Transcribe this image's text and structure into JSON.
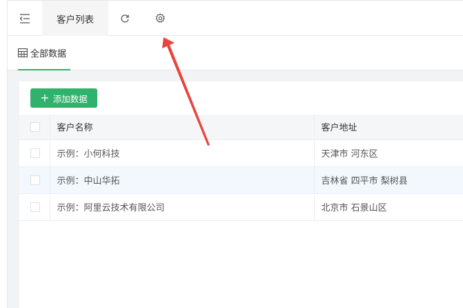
{
  "topbar": {
    "tab_label": "客户列表",
    "icons": [
      "menu-fold-icon",
      "refresh-icon",
      "gear-icon"
    ]
  },
  "view_tab": {
    "label": "全部数据",
    "icon": "table-icon"
  },
  "toolbar": {
    "add_label": "添加数据",
    "add_icon": "plus-icon"
  },
  "colors": {
    "accent": "#2fb26b",
    "annotation": "#e8453c"
  },
  "table": {
    "headers": [
      "客户名称",
      "客户地址"
    ],
    "rows": [
      {
        "name": "示例：小何科技",
        "address": "天津市 河东区"
      },
      {
        "name": "示例：中山华拓",
        "address": "吉林省 四平市 梨树县"
      },
      {
        "name": "示例：阿里云技术有限公司",
        "address": "北京市 石景山区"
      }
    ]
  }
}
